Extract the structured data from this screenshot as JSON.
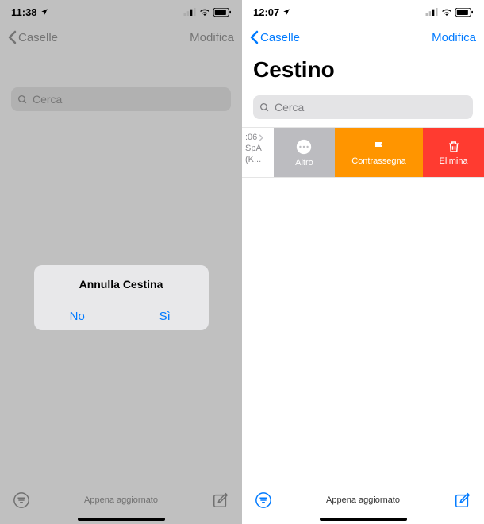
{
  "left": {
    "status": {
      "time": "11:38"
    },
    "nav": {
      "back": "Caselle",
      "edit": "Modifica"
    },
    "search": {
      "placeholder": "Cerca"
    },
    "alert": {
      "title": "Annulla Cestina",
      "no": "No",
      "si": "Sì"
    },
    "toolbar": {
      "status": "Appena aggiornato"
    }
  },
  "right": {
    "status": {
      "time": "12:07"
    },
    "nav": {
      "back": "Caselle",
      "edit": "Modifica"
    },
    "title": "Cestino",
    "search": {
      "placeholder": "Cerca"
    },
    "row": {
      "time": ":06",
      "line2": "SpA",
      "line3": "(K..."
    },
    "swipe": {
      "more": "Altro",
      "flag": "Contrassegna",
      "del": "Elimina"
    },
    "toolbar": {
      "status": "Appena aggiornato"
    }
  }
}
